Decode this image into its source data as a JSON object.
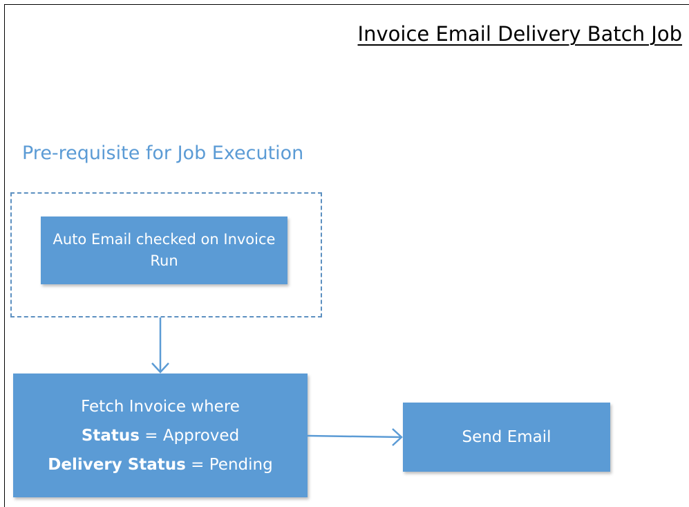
{
  "title": "Invoice Email Delivery Batch Job",
  "prerequisite_label": "Pre-requisite for Job Execution",
  "nodes": {
    "prerequisite": {
      "text": "Auto Email checked on Invoice Run"
    },
    "fetch": {
      "line1": "Fetch Invoice where",
      "status_key": "Status",
      "status_value": "= Approved",
      "delivery_key": "Delivery Status",
      "delivery_value": "= Pending"
    },
    "send": {
      "text": "Send Email"
    }
  },
  "edges": [
    {
      "from": "prerequisite",
      "to": "fetch"
    },
    {
      "from": "fetch",
      "to": "send"
    }
  ],
  "colors": {
    "node_fill": "#5b9bd5",
    "node_text": "#ffffff",
    "connector": "#5b9bd5",
    "label": "#5b9bd5",
    "group_border": "#5b8fc0"
  }
}
